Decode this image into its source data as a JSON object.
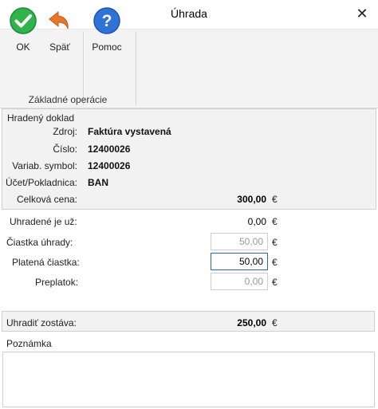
{
  "window": {
    "title": "Úhrada"
  },
  "ribbon": {
    "buttons": [
      {
        "label": "OK",
        "icon": "check-icon",
        "color": "#2fb34a"
      },
      {
        "label": "Späť",
        "icon": "undo-icon",
        "color": "#e8772e"
      },
      {
        "label": "Pomoc",
        "icon": "help-icon",
        "color": "#2f73d8"
      }
    ],
    "group_label": "Základné operácie"
  },
  "doc": {
    "title": "Hradený doklad",
    "zdroj_label": "Zdroj:",
    "zdroj_value": "Faktúra vystavená",
    "cislo_label": "Číslo:",
    "cislo_value": "12400026",
    "vs_label": "Variab. symbol:",
    "vs_value": "12400026",
    "ucet_label": "Účet/Pokladnica:",
    "ucet_value": "BAN",
    "celkova_label": "Celková cena:",
    "celkova_value": "300,00",
    "currency": "€"
  },
  "payment": {
    "uhradene_label": "Uhradené je už:",
    "uhradene_value": "0,00",
    "ciastka_label": "Čiastka úhrady:",
    "ciastka_value": "50,00",
    "platena_label": "Platená čiastka:",
    "platena_value": "50,00",
    "preplatok_label": "Preplatok:",
    "preplatok_value": "0,00",
    "zostava_label": "Uhradiť zostáva:",
    "zostava_value": "250,00"
  },
  "note": {
    "label": "Poznámka",
    "value": ""
  }
}
